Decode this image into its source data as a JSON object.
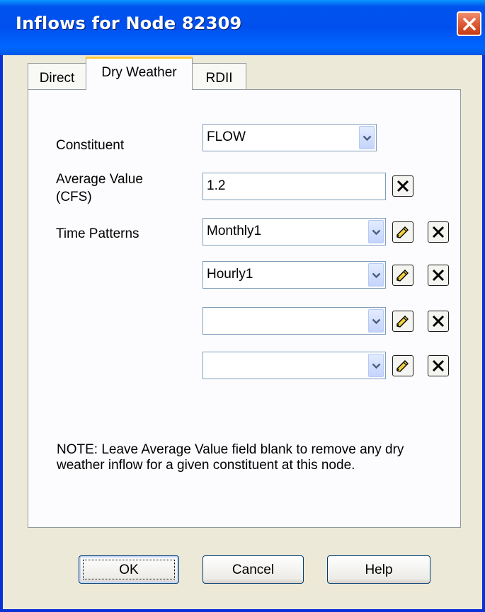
{
  "window": {
    "title": "Inflows for Node 82309"
  },
  "tabs": [
    {
      "label": "Direct"
    },
    {
      "label": "Dry Weather"
    },
    {
      "label": "RDII"
    }
  ],
  "form": {
    "constituent_label": "Constituent",
    "constituent_value": "FLOW",
    "average_label_line1": "Average Value",
    "average_label_line2": "(CFS)",
    "average_value": "1.2",
    "patterns_label": "Time Patterns",
    "patterns": [
      {
        "value": "Monthly1"
      },
      {
        "value": "Hourly1"
      },
      {
        "value": ""
      },
      {
        "value": ""
      }
    ]
  },
  "note": "NOTE: Leave Average Value field blank to remove any dry weather inflow for a given constituent at this node.",
  "buttons": {
    "ok": "OK",
    "cancel": "Cancel",
    "help": "Help"
  },
  "colors": {
    "titlebar": "#0054e3",
    "close": "#e0603a",
    "dialog": "#ece9d8",
    "active_tab_accent": "#ffc83c"
  },
  "icons": {
    "close": "close-icon",
    "dropdown": "chevron-down-icon",
    "edit": "edit-pencil-icon",
    "clear": "clear-x-icon"
  }
}
